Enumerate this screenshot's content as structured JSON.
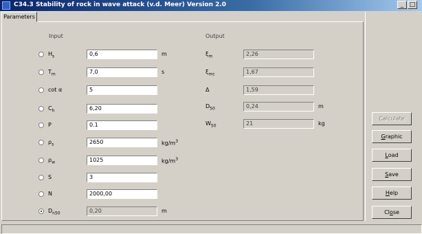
{
  "window": {
    "title": "C34.3 Stability of rock in wave attack (v.d. Meer) Version 2.0",
    "controls": [
      "_",
      "□",
      "x"
    ]
  },
  "tab": "Parameters",
  "input": {
    "heading": "Input",
    "rows": [
      {
        "sym": "H",
        "sub": "s",
        "value": "0,6",
        "unit": "m",
        "sup": "",
        "selected": false,
        "readonly": false
      },
      {
        "sym": "T",
        "sub": "m",
        "value": "7,0",
        "unit": "s",
        "sup": "",
        "selected": false,
        "readonly": false
      },
      {
        "sym": "cot α",
        "sub": "",
        "value": "5",
        "unit": "",
        "sup": "",
        "selected": false,
        "readonly": false
      },
      {
        "sym": "C",
        "sub": "h",
        "value": "6,20",
        "unit": "",
        "sup": "",
        "selected": false,
        "readonly": false
      },
      {
        "sym": "P",
        "sub": "",
        "value": "0.1",
        "unit": "",
        "sup": "",
        "selected": false,
        "readonly": false
      },
      {
        "sym": "ρ",
        "sub": "s",
        "value": "2650",
        "unit": "kg/m",
        "sup": "3",
        "selected": false,
        "readonly": false
      },
      {
        "sym": "ρ",
        "sub": "w",
        "value": "1025",
        "unit": "kg/m",
        "sup": "3",
        "selected": false,
        "readonly": false
      },
      {
        "sym": "S",
        "sub": "",
        "value": "3",
        "unit": "",
        "sup": "",
        "selected": false,
        "readonly": false
      },
      {
        "sym": "N",
        "sub": "",
        "value": "2000,00",
        "unit": "",
        "sup": "",
        "selected": false,
        "readonly": false
      },
      {
        "sym": "D",
        "sub": "n50",
        "value": "0,20",
        "unit": "m",
        "sup": "",
        "selected": true,
        "readonly": true
      }
    ]
  },
  "output": {
    "heading": "Output",
    "rows": [
      {
        "sym": "ξ",
        "sub": "m",
        "value": "2,26",
        "unit": ""
      },
      {
        "sym": "ξ",
        "sub": "mc",
        "value": "1,67",
        "unit": ""
      },
      {
        "sym": "Δ",
        "sub": "",
        "value": "1,59",
        "unit": ""
      },
      {
        "sym": "D",
        "sub": "50",
        "value": "0,24",
        "unit": "m"
      },
      {
        "sym": "W",
        "sub": "50",
        "value": "21",
        "unit": "kg"
      }
    ]
  },
  "buttons": {
    "calculate": {
      "pre": "",
      "u": "",
      "post": "Calculate"
    },
    "graphic": {
      "pre": "",
      "u": "G",
      "post": "raphic"
    },
    "load": {
      "pre": "",
      "u": "L",
      "post": "oad"
    },
    "save": {
      "pre": "",
      "u": "S",
      "post": "ave"
    },
    "help": {
      "pre": "",
      "u": "H",
      "post": "elp"
    },
    "close": {
      "pre": "Cl",
      "u": "o",
      "post": "se"
    }
  }
}
